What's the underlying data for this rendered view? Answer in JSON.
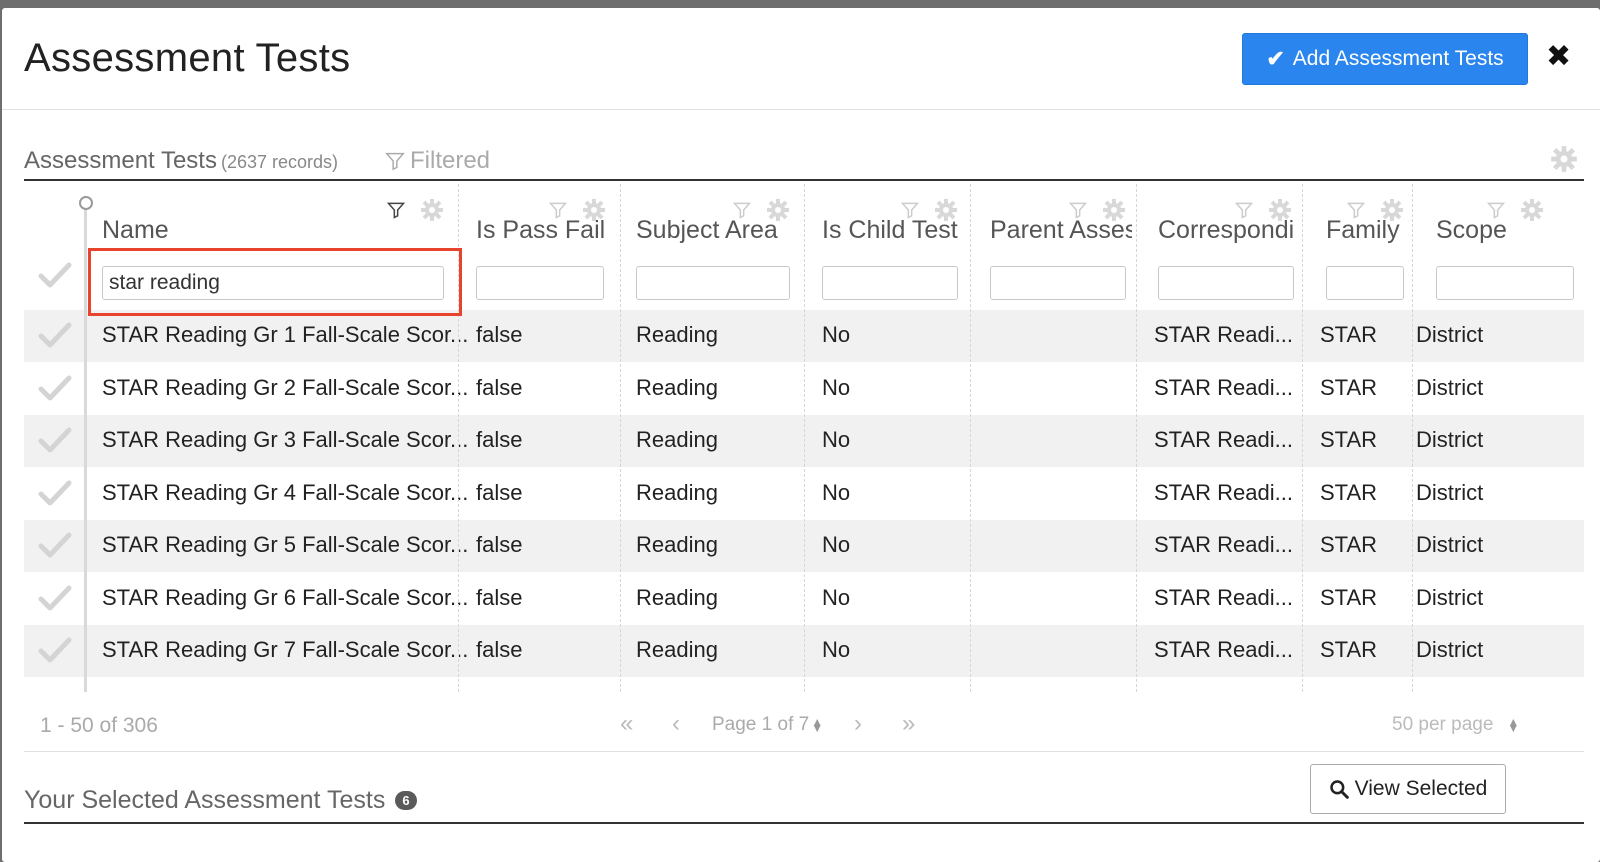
{
  "modal": {
    "title": "Assessment Tests",
    "add_button_label": "Add Assessment Tests"
  },
  "section": {
    "title": "Assessment Tests",
    "record_count": "(2637 records)",
    "filtered_label": "Filtered"
  },
  "columns": [
    {
      "title": "Name",
      "filter_value": "star reading"
    },
    {
      "title": "Is Pass Fail",
      "filter_value": ""
    },
    {
      "title": "Subject Area",
      "filter_value": ""
    },
    {
      "title": "Is Child Test",
      "filter_value": ""
    },
    {
      "title": "Parent Asses",
      "filter_value": ""
    },
    {
      "title": "Correspondi",
      "filter_value": ""
    },
    {
      "title": "Family",
      "filter_value": ""
    },
    {
      "title": "Scope",
      "filter_value": ""
    }
  ],
  "rows": [
    {
      "name": "STAR Reading Gr 1 Fall-Scale Scor...",
      "is_pass_fail": "false",
      "subject_area": "Reading",
      "is_child_test": "No",
      "parent": "",
      "corresponding": "STAR Readi...",
      "family": "STAR",
      "scope": "District"
    },
    {
      "name": "STAR Reading Gr 2 Fall-Scale Scor...",
      "is_pass_fail": "false",
      "subject_area": "Reading",
      "is_child_test": "No",
      "parent": "",
      "corresponding": "STAR Readi...",
      "family": "STAR",
      "scope": "District"
    },
    {
      "name": "STAR Reading Gr 3 Fall-Scale Scor...",
      "is_pass_fail": "false",
      "subject_area": "Reading",
      "is_child_test": "No",
      "parent": "",
      "corresponding": "STAR Readi...",
      "family": "STAR",
      "scope": "District"
    },
    {
      "name": "STAR Reading Gr 4 Fall-Scale Scor...",
      "is_pass_fail": "false",
      "subject_area": "Reading",
      "is_child_test": "No",
      "parent": "",
      "corresponding": "STAR Readi...",
      "family": "STAR",
      "scope": "District"
    },
    {
      "name": "STAR Reading Gr 5 Fall-Scale Scor...",
      "is_pass_fail": "false",
      "subject_area": "Reading",
      "is_child_test": "No",
      "parent": "",
      "corresponding": "STAR Readi...",
      "family": "STAR",
      "scope": "District"
    },
    {
      "name": "STAR Reading Gr 6 Fall-Scale Scor...",
      "is_pass_fail": "false",
      "subject_area": "Reading",
      "is_child_test": "No",
      "parent": "",
      "corresponding": "STAR Readi...",
      "family": "STAR",
      "scope": "District"
    },
    {
      "name": "STAR Reading Gr 7 Fall-Scale Scor...",
      "is_pass_fail": "false",
      "subject_area": "Reading",
      "is_child_test": "No",
      "parent": "",
      "corresponding": "STAR Readi...",
      "family": "STAR",
      "scope": "District"
    }
  ],
  "pager": {
    "range": "1 - 50 of 306",
    "page_info": "Page 1 of 7",
    "per_page": "50 per page"
  },
  "selected": {
    "title": "Your Selected Assessment Tests",
    "count": "6",
    "view_button_label": "View Selected"
  },
  "colors": {
    "primary": "#2a86ee",
    "highlight": "#e8432d"
  },
  "icons": [
    "check-icon",
    "close-icon",
    "filter-icon",
    "gear-icon",
    "search-icon",
    "first-page-icon",
    "prev-page-icon",
    "next-page-icon",
    "last-page-icon"
  ]
}
